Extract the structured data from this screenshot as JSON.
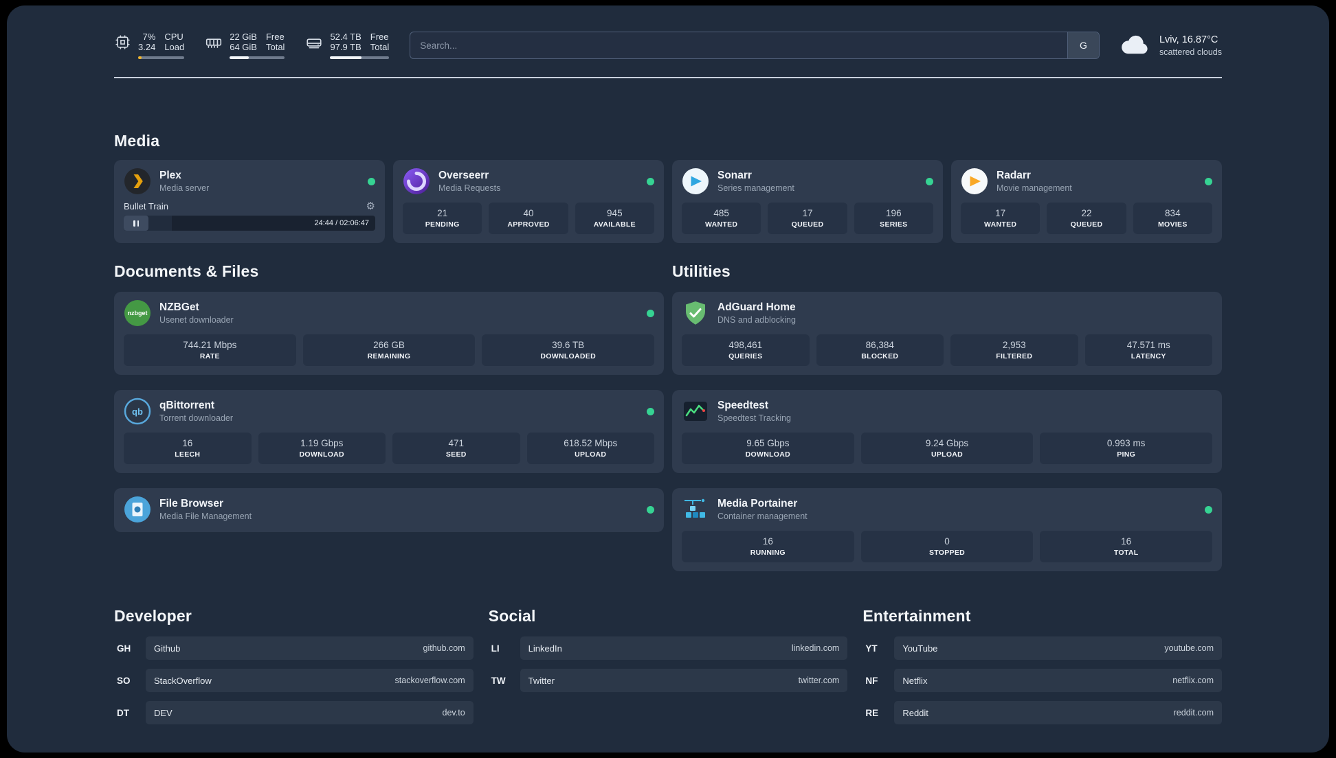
{
  "icons": {
    "gear": "⚙"
  },
  "theme": {
    "panel_bg": "#202c3d",
    "card_bg": "#2f3b4e",
    "tile_bg": "#263245",
    "status_green": "#36d393",
    "cpu_bar_color": "#f0b429",
    "bar_fill_color": "#f1f5f9"
  },
  "topbar": {
    "metrics": [
      {
        "icon": "cpu-icon",
        "values": [
          "7%",
          "3.24"
        ],
        "labels": [
          "CPU",
          "Load"
        ],
        "progress": 7,
        "bar_color": "#f0b429"
      },
      {
        "icon": "ram-icon",
        "values": [
          "22 GiB",
          "64 GiB"
        ],
        "labels": [
          "Free",
          "Total"
        ],
        "progress": 34,
        "bar_color": "#f1f5f9"
      },
      {
        "icon": "disk-icon",
        "values": [
          "52.4 TB",
          "97.9 TB"
        ],
        "labels": [
          "Free",
          "Total"
        ],
        "progress": 53,
        "bar_color": "#f1f5f9"
      }
    ],
    "search": {
      "placeholder": "Search...",
      "engine_label": "G"
    },
    "weather": {
      "icon": "cloud-icon",
      "location": "Lviv, 16.87°C",
      "condition": "scattered clouds"
    }
  },
  "media": {
    "title": "Media",
    "apps": [
      {
        "icon": "plex-icon",
        "name": "Plex",
        "subtitle": "Media server",
        "status": "online",
        "player": {
          "title": "Bullet Train",
          "time": "24:44 / 02:06:47",
          "progress": 19
        }
      },
      {
        "icon": "overseerr-icon",
        "name": "Overseerr",
        "subtitle": "Media Requests",
        "status": "online",
        "stats": [
          {
            "value": "21",
            "label": "PENDING"
          },
          {
            "value": "40",
            "label": "APPROVED"
          },
          {
            "value": "945",
            "label": "AVAILABLE"
          }
        ]
      },
      {
        "icon": "sonarr-icon",
        "name": "Sonarr",
        "subtitle": "Series management",
        "status": "online",
        "stats": [
          {
            "value": "485",
            "label": "WANTED"
          },
          {
            "value": "17",
            "label": "QUEUED"
          },
          {
            "value": "196",
            "label": "SERIES"
          }
        ]
      },
      {
        "icon": "radarr-icon",
        "name": "Radarr",
        "subtitle": "Movie management",
        "status": "online",
        "stats": [
          {
            "value": "17",
            "label": "WANTED"
          },
          {
            "value": "22",
            "label": "QUEUED"
          },
          {
            "value": "834",
            "label": "MOVIES"
          }
        ]
      }
    ]
  },
  "documents": {
    "title": "Documents & Files",
    "apps": [
      {
        "icon": "nzbget-icon",
        "name": "NZBGet",
        "subtitle": "Usenet downloader",
        "status": "online",
        "stats": [
          {
            "value": "744.21 Mbps",
            "label": "RATE"
          },
          {
            "value": "266 GB",
            "label": "REMAINING"
          },
          {
            "value": "39.6 TB",
            "label": "DOWNLOADED"
          }
        ]
      },
      {
        "icon": "qbittorrent-icon",
        "name": "qBittorrent",
        "subtitle": "Torrent downloader",
        "status": "online",
        "stats": [
          {
            "value": "16",
            "label": "LEECH"
          },
          {
            "value": "1.19 Gbps",
            "label": "DOWNLOAD"
          },
          {
            "value": "471",
            "label": "SEED"
          },
          {
            "value": "618.52 Mbps",
            "label": "UPLOAD"
          }
        ]
      },
      {
        "icon": "filebrowser-icon",
        "name": "File Browser",
        "subtitle": "Media File Management",
        "status": "online"
      }
    ]
  },
  "utilities": {
    "title": "Utilities",
    "apps": [
      {
        "icon": "adguard-icon",
        "name": "AdGuard Home",
        "subtitle": "DNS and adblocking",
        "stats": [
          {
            "value": "498,461",
            "label": "QUERIES"
          },
          {
            "value": "86,384",
            "label": "BLOCKED"
          },
          {
            "value": "2,953",
            "label": "FILTERED"
          },
          {
            "value": "47.571 ms",
            "label": "LATENCY"
          }
        ]
      },
      {
        "icon": "speedtest-icon",
        "name": "Speedtest",
        "subtitle": "Speedtest Tracking",
        "stats": [
          {
            "value": "9.65 Gbps",
            "label": "DOWNLOAD"
          },
          {
            "value": "9.24 Gbps",
            "label": "UPLOAD"
          },
          {
            "value": "0.993 ms",
            "label": "PING"
          }
        ]
      },
      {
        "icon": "portainer-icon",
        "name": "Media Portainer",
        "subtitle": "Container management",
        "status": "online",
        "stats": [
          {
            "value": "16",
            "label": "RUNNING"
          },
          {
            "value": "0",
            "label": "STOPPED"
          },
          {
            "value": "16",
            "label": "TOTAL"
          }
        ]
      }
    ]
  },
  "bookmarks": {
    "groups": [
      {
        "title": "Developer",
        "items": [
          {
            "abbr": "GH",
            "name": "Github",
            "url": "github.com"
          },
          {
            "abbr": "SO",
            "name": "StackOverflow",
            "url": "stackoverflow.com"
          },
          {
            "abbr": "DT",
            "name": "DEV",
            "url": "dev.to"
          }
        ]
      },
      {
        "title": "Social",
        "items": [
          {
            "abbr": "LI",
            "name": "LinkedIn",
            "url": "linkedin.com"
          },
          {
            "abbr": "TW",
            "name": "Twitter",
            "url": "twitter.com"
          }
        ]
      },
      {
        "title": "Entertainment",
        "items": [
          {
            "abbr": "YT",
            "name": "YouTube",
            "url": "youtube.com"
          },
          {
            "abbr": "NF",
            "name": "Netflix",
            "url": "netflix.com"
          },
          {
            "abbr": "RE",
            "name": "Reddit",
            "url": "reddit.com"
          }
        ]
      }
    ]
  }
}
